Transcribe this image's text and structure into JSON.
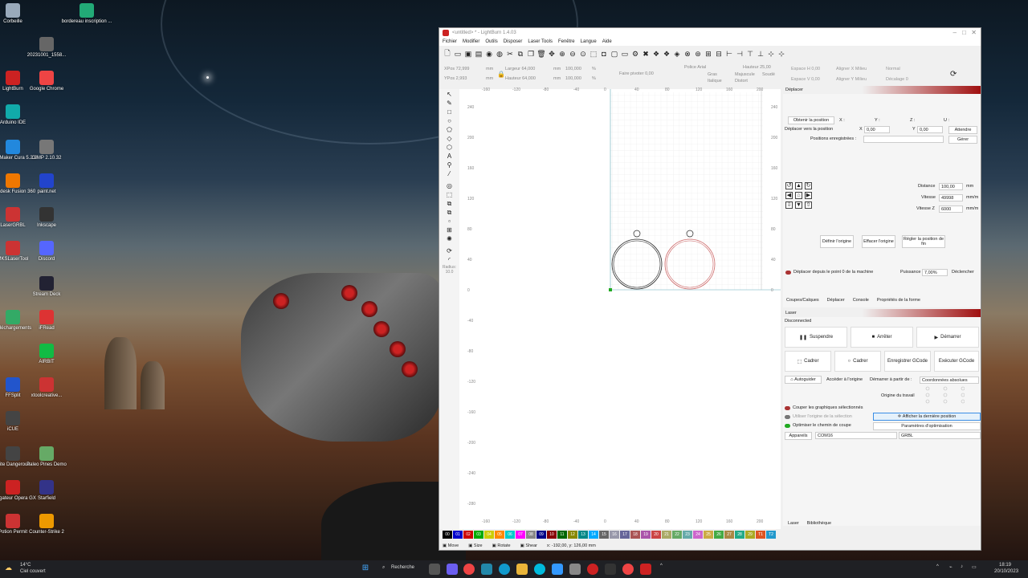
{
  "desktop": {
    "icons": [
      {
        "label": "Corbeille",
        "color": "#9ab"
      },
      {
        "label": "bordereau inscription ...",
        "color": "#2a7"
      },
      {
        "label": "20231001_1558...",
        "color": "#666"
      },
      {
        "label": "LightBurn",
        "color": "#c22"
      },
      {
        "label": "Google Chrome",
        "color": "#e44"
      },
      {
        "label": "Arduino IDE",
        "color": "#1aa"
      },
      {
        "label": "LitheMaker Cura 5.2.2",
        "color": "#28d"
      },
      {
        "label": "GIMP 2.10.32",
        "color": "#777"
      },
      {
        "label": "Autodesk Fusion 360",
        "color": "#e70"
      },
      {
        "label": "paint.net",
        "color": "#24c"
      },
      {
        "label": "LaserGRBL",
        "color": "#c33"
      },
      {
        "label": "Inkscape",
        "color": "#333"
      },
      {
        "label": "MKSLaserTool",
        "color": "#c33"
      },
      {
        "label": "Discord",
        "color": "#56f"
      },
      {
        "label": "Stream Deck",
        "color": "#223"
      },
      {
        "label": "Téléchargements",
        "color": "#3a6"
      },
      {
        "label": "iFRead",
        "color": "#d33"
      },
      {
        "label": "AIRBIT",
        "color": "#1b4"
      },
      {
        "label": "FFSplit",
        "color": "#25c"
      },
      {
        "label": "xtoolcreative...",
        "color": "#c33"
      },
      {
        "label": "iCUE",
        "color": "#444"
      },
      {
        "label": "Elite Dangerous",
        "color": "#444"
      },
      {
        "label": "Paleo Pines Demo",
        "color": "#6a6"
      },
      {
        "label": "Navigateur Opera GX",
        "color": "#c22"
      },
      {
        "label": "Starfield",
        "color": "#338"
      },
      {
        "label": "Potion Permit",
        "color": "#c33"
      },
      {
        "label": "Counter-Strike 2",
        "color": "#e90"
      }
    ]
  },
  "app": {
    "title": "<untitled> * - LightBurn 1.4.03",
    "menu": [
      "Fichier",
      "Modifier",
      "Outils",
      "Disposer",
      "Laser Tools",
      "Fenêtre",
      "Langue",
      "Aide"
    ],
    "props": {
      "xpos": "XPos 72,999",
      "ypos": "YPos 2,993",
      "mm1": "mm",
      "mm2": "mm",
      "largeur": "Largeur 64,000",
      "hauteur": "Hauteur 64,000",
      "mm3": "mm",
      "mm4": "mm",
      "pct1": "100,000",
      "pct2": "100,000",
      "pctsym1": "%",
      "pctsym2": "%",
      "rotate": "Faire pivoter 0,00",
      "police": "Police Arial",
      "gras": "Gras",
      "italique": "Italique",
      "majuscule": "Majuscule",
      "distort": "Distort",
      "soude": "Soudé",
      "hauteur_t": "Hauteur 25,00",
      "espace_h": "Espace H 0,00",
      "espace_v": "Espace V 0,00",
      "aligner_x": "Aligner X Milieu",
      "aligner_y": "Aligner Y Milieu",
      "normal": "Normal",
      "decalage": "Décalage 0"
    },
    "radius": "Radius:\n10.0",
    "ruler_top": [
      "-160",
      "-120",
      "-80",
      "-40",
      "0",
      "40",
      "80",
      "120",
      "160",
      "200"
    ],
    "ruler_left": [
      "240",
      "200",
      "160",
      "120",
      "80",
      "40",
      "0",
      "-40",
      "-80",
      "-120",
      "-160",
      "-200",
      "-240",
      "-280"
    ],
    "palette": [
      "00",
      "01",
      "02",
      "03",
      "04",
      "05",
      "06",
      "07",
      "08",
      "09",
      "10",
      "11",
      "12",
      "13",
      "14",
      "15",
      "16",
      "17",
      "18",
      "19",
      "20",
      "21",
      "22",
      "23",
      "24",
      "25",
      "26",
      "27",
      "28",
      "29",
      "T1",
      "T2"
    ],
    "palette_colors": [
      "#000",
      "#00c",
      "#c00",
      "#0a0",
      "#cc0",
      "#f80",
      "#0cc",
      "#f0f",
      "#888",
      "#008",
      "#800",
      "#060",
      "#880",
      "#088",
      "#0af",
      "#666",
      "#99a",
      "#669",
      "#a55",
      "#a5a",
      "#c44",
      "#aa6",
      "#6a6",
      "#6aa",
      "#c6c",
      "#ca4",
      "#4a4",
      "#a84",
      "#2a8",
      "#aa2",
      "#d52",
      "#29c"
    ],
    "statusbar": {
      "move": "Move",
      "size": "Size",
      "rotate": "Rotate",
      "shear": "Shear",
      "coords": "x: -192,00, y: 126,00 mm"
    }
  },
  "move_panel": {
    "title": "Déplacer",
    "get_pos": "Obtenir la position",
    "x": "X :",
    "y": "Y :",
    "z": "Z :",
    "u": "U :",
    "move_to": "Déplacer vers la position",
    "x_val": "0,00",
    "y_val": "0,00",
    "x_lbl": "X",
    "y_lbl": "Y",
    "wait": "Attendre",
    "saved": "Positions enregistrées :",
    "manage": "Gérer",
    "distance_lbl": "Distance",
    "distance": "100,00",
    "mm": "mm",
    "speed_lbl": "Vitesse",
    "speed": "49998",
    "mms": "mm/m",
    "speedz_lbl": "Vitesse Z",
    "speedz": "6000",
    "mms2": "mm/m",
    "set_origin": "Définir l'origine",
    "clear_origin": "Effacer l'origine",
    "set_end": "Régler la position de fin",
    "from_zero": "Déplacer depuis le point 0 de la machine",
    "power_lbl": "Puissance",
    "power": "7,00%",
    "fire": "Déclencher",
    "tabs": [
      "Coupes/Calques",
      "Déplacer",
      "Console",
      "Propriétés de la forme"
    ]
  },
  "laser_panel": {
    "title": "Laser",
    "status": "Disconnected",
    "pause": "Suspendre",
    "stop": "Arrêter",
    "start": "Démarrer",
    "frame1": "Cadrer",
    "frame2": "Cadrer",
    "save_gcode": "Enregistrer GCode",
    "run_gcode": "Exécuter GCode",
    "home": "Autoguider",
    "go_origin": "Accéder à l'origine",
    "start_from": "Démarrer à partir de :",
    "coords": "Coordonnées absolues",
    "job_origin": "Origine du travail",
    "cut_selected": "Couper les graphiques sélectionnés",
    "use_origin": "Utiliser l'origine de la sélection",
    "show_last": "Afficher la dernière position",
    "optimize": "Optimiser le chemin de coupe",
    "opt_params": "Paramètres d'optimisation",
    "devices": "Appareils",
    "port": "COM16",
    "controller": "GRBL",
    "tabs": [
      "Laser",
      "Bibliothèque"
    ]
  },
  "taskbar": {
    "temp": "14°C",
    "weather": "Ciel couvert",
    "search": "Recherche",
    "time": "18:19",
    "date": "20/10/2023"
  }
}
